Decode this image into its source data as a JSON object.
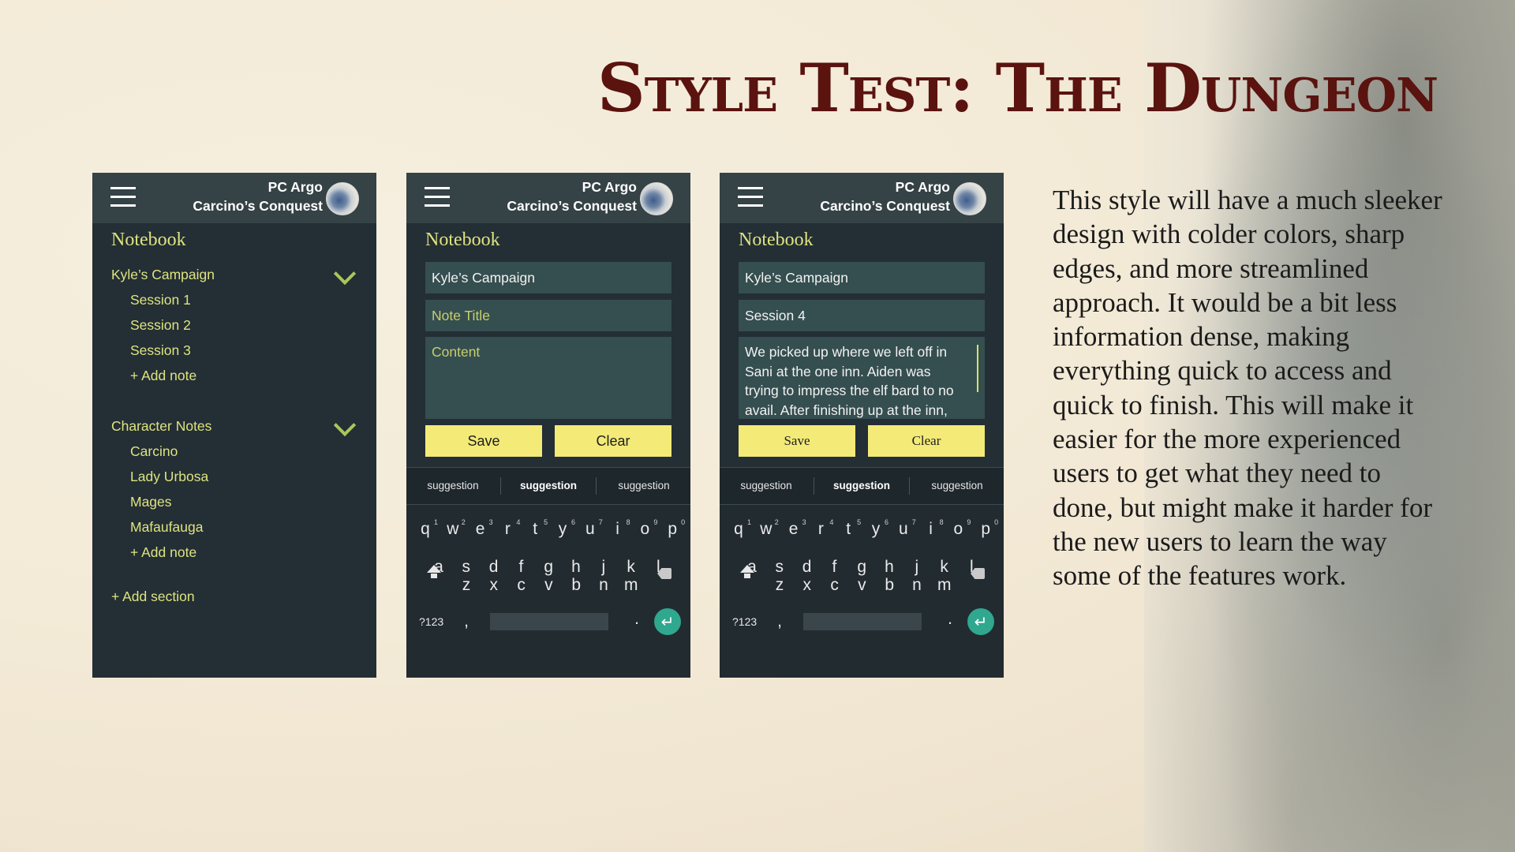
{
  "slide": {
    "title": "Style Test: The Dungeon",
    "description": "This style will have a much sleeker design with colder colors, sharp edges, and more streamlined approach. It would be a bit less information dense, making everything quick to access and quick to finish. This will make it easier for the more experienced users to get what they need to done, but might make it harder for the new users to learn the way some of the features work."
  },
  "header": {
    "user": "PC Argo",
    "subtitle": "Carcino’s Conquest"
  },
  "notebook_title": "Notebook",
  "phone1": {
    "sections": [
      {
        "label": "Kyle’s Campaign",
        "items": [
          "Session 1",
          "Session 2",
          "Session 3"
        ],
        "add": "+ Add note"
      },
      {
        "label": "Character Notes",
        "items": [
          "Carcino",
          "Lady Urbosa",
          "Mages",
          "Mafaufauga"
        ],
        "add": "+ Add note"
      }
    ],
    "add_section": "+ Add section"
  },
  "phone2": {
    "campaign": "Kyle’s Campaign",
    "title_placeholder": "Note Title",
    "content_placeholder": "Content",
    "save": "Save",
    "clear": "Clear"
  },
  "phone3": {
    "campaign": "Kyle’s Campaign",
    "title": "Session 4",
    "content": "We picked up where we left off in Sani at the one inn. Aiden was trying to impress the elf bard to no avail. After finishing up at the inn,",
    "save": "Save",
    "clear": "Clear"
  },
  "keyboard": {
    "suggestions": [
      "suggestion",
      "suggestion",
      "suggestion"
    ],
    "row1": [
      "q",
      "w",
      "e",
      "r",
      "t",
      "y",
      "u",
      "i",
      "o",
      "p"
    ],
    "row1_nums": [
      "1",
      "2",
      "3",
      "4",
      "5",
      "6",
      "7",
      "8",
      "9",
      "0"
    ],
    "row2": [
      "a",
      "s",
      "d",
      "f",
      "g",
      "h",
      "j",
      "k",
      "l"
    ],
    "row3": [
      "z",
      "x",
      "c",
      "v",
      "b",
      "n",
      "m"
    ],
    "symbols": "?123",
    "comma": ",",
    "period": "."
  },
  "colors": {
    "accent": "#dde47f",
    "panel": "#242e35",
    "header": "#354246",
    "button": "#f3ea78",
    "title": "#5a130f"
  }
}
